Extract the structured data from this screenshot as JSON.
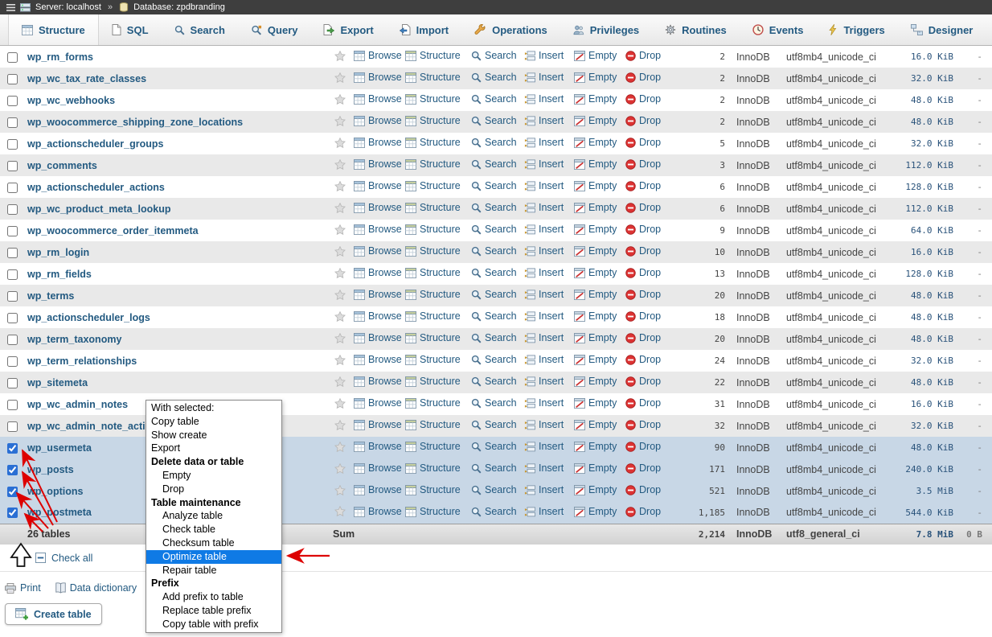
{
  "topbar": {
    "server_label": "Server: localhost",
    "separator": "»",
    "database_label": "Database: zpdbranding",
    "icons": [
      "menu-icon",
      "server-icon",
      "database-icon"
    ]
  },
  "tabs": [
    {
      "label": "Structure",
      "icon": "tab-structure",
      "active": true
    },
    {
      "label": "SQL",
      "icon": "tab-sql"
    },
    {
      "label": "Search",
      "icon": "tab-search"
    },
    {
      "label": "Query",
      "icon": "tab-query"
    },
    {
      "label": "Export",
      "icon": "tab-export"
    },
    {
      "label": "Import",
      "icon": "tab-import"
    },
    {
      "label": "Operations",
      "icon": "tab-operations"
    },
    {
      "label": "Privileges",
      "icon": "tab-privileges"
    },
    {
      "label": "Routines",
      "icon": "tab-routines"
    },
    {
      "label": "Events",
      "icon": "tab-events"
    },
    {
      "label": "Triggers",
      "icon": "tab-triggers"
    },
    {
      "label": "Designer",
      "icon": "tab-designer"
    }
  ],
  "row_actions": [
    {
      "label": "Browse",
      "icon": "browse"
    },
    {
      "label": "Structure",
      "icon": "structure"
    },
    {
      "label": "Search",
      "icon": "search"
    },
    {
      "label": "Insert",
      "icon": "insert"
    },
    {
      "label": "Empty",
      "icon": "empty"
    },
    {
      "label": "Drop",
      "icon": "drop"
    }
  ],
  "tables": [
    {
      "name": "wp_rm_forms",
      "rows": "2",
      "engine": "InnoDB",
      "collation": "utf8mb4_unicode_ci",
      "size": "16.0 KiB",
      "overhead": "-",
      "checked": false
    },
    {
      "name": "wp_wc_tax_rate_classes",
      "rows": "2",
      "engine": "InnoDB",
      "collation": "utf8mb4_unicode_ci",
      "size": "32.0 KiB",
      "overhead": "-",
      "checked": false
    },
    {
      "name": "wp_wc_webhooks",
      "rows": "2",
      "engine": "InnoDB",
      "collation": "utf8mb4_unicode_ci",
      "size": "48.0 KiB",
      "overhead": "-",
      "checked": false
    },
    {
      "name": "wp_woocommerce_shipping_zone_locations",
      "rows": "2",
      "engine": "InnoDB",
      "collation": "utf8mb4_unicode_ci",
      "size": "48.0 KiB",
      "overhead": "-",
      "checked": false
    },
    {
      "name": "wp_actionscheduler_groups",
      "rows": "5",
      "engine": "InnoDB",
      "collation": "utf8mb4_unicode_ci",
      "size": "32.0 KiB",
      "overhead": "-",
      "checked": false
    },
    {
      "name": "wp_comments",
      "rows": "3",
      "engine": "InnoDB",
      "collation": "utf8mb4_unicode_ci",
      "size": "112.0 KiB",
      "overhead": "-",
      "checked": false
    },
    {
      "name": "wp_actionscheduler_actions",
      "rows": "6",
      "engine": "InnoDB",
      "collation": "utf8mb4_unicode_ci",
      "size": "128.0 KiB",
      "overhead": "-",
      "checked": false
    },
    {
      "name": "wp_wc_product_meta_lookup",
      "rows": "6",
      "engine": "InnoDB",
      "collation": "utf8mb4_unicode_ci",
      "size": "112.0 KiB",
      "overhead": "-",
      "checked": false
    },
    {
      "name": "wp_woocommerce_order_itemmeta",
      "rows": "9",
      "engine": "InnoDB",
      "collation": "utf8mb4_unicode_ci",
      "size": "64.0 KiB",
      "overhead": "-",
      "checked": false
    },
    {
      "name": "wp_rm_login",
      "rows": "10",
      "engine": "InnoDB",
      "collation": "utf8mb4_unicode_ci",
      "size": "16.0 KiB",
      "overhead": "-",
      "checked": false
    },
    {
      "name": "wp_rm_fields",
      "rows": "13",
      "engine": "InnoDB",
      "collation": "utf8mb4_unicode_ci",
      "size": "128.0 KiB",
      "overhead": "-",
      "checked": false
    },
    {
      "name": "wp_terms",
      "rows": "20",
      "engine": "InnoDB",
      "collation": "utf8mb4_unicode_ci",
      "size": "48.0 KiB",
      "overhead": "-",
      "checked": false
    },
    {
      "name": "wp_actionscheduler_logs",
      "rows": "18",
      "engine": "InnoDB",
      "collation": "utf8mb4_unicode_ci",
      "size": "48.0 KiB",
      "overhead": "-",
      "checked": false
    },
    {
      "name": "wp_term_taxonomy",
      "rows": "20",
      "engine": "InnoDB",
      "collation": "utf8mb4_unicode_ci",
      "size": "48.0 KiB",
      "overhead": "-",
      "checked": false
    },
    {
      "name": "wp_term_relationships",
      "rows": "24",
      "engine": "InnoDB",
      "collation": "utf8mb4_unicode_ci",
      "size": "32.0 KiB",
      "overhead": "-",
      "checked": false
    },
    {
      "name": "wp_sitemeta",
      "rows": "22",
      "engine": "InnoDB",
      "collation": "utf8mb4_unicode_ci",
      "size": "48.0 KiB",
      "overhead": "-",
      "checked": false
    },
    {
      "name": "wp_wc_admin_notes",
      "rows": "31",
      "engine": "InnoDB",
      "collation": "utf8mb4_unicode_ci",
      "size": "16.0 KiB",
      "overhead": "-",
      "checked": false
    },
    {
      "name": "wp_wc_admin_note_actions",
      "rows": "32",
      "engine": "InnoDB",
      "collation": "utf8mb4_unicode_ci",
      "size": "32.0 KiB",
      "overhead": "-",
      "checked": false
    },
    {
      "name": "wp_usermeta",
      "rows": "90",
      "engine": "InnoDB",
      "collation": "utf8mb4_unicode_ci",
      "size": "48.0 KiB",
      "overhead": "-",
      "checked": true
    },
    {
      "name": "wp_posts",
      "rows": "171",
      "engine": "InnoDB",
      "collation": "utf8mb4_unicode_ci",
      "size": "240.0 KiB",
      "overhead": "-",
      "checked": true
    },
    {
      "name": "wp_options",
      "rows": "521",
      "engine": "InnoDB",
      "collation": "utf8mb4_unicode_ci",
      "size": "3.5 MiB",
      "overhead": "-",
      "checked": true
    },
    {
      "name": "wp_postmeta",
      "rows": "1,185",
      "engine": "InnoDB",
      "collation": "utf8mb4_unicode_ci",
      "size": "544.0 KiB",
      "overhead": "-",
      "checked": true
    }
  ],
  "sum_row": {
    "tables_label": "26 tables",
    "sum_label": "Sum",
    "rows": "2,214",
    "engine": "InnoDB",
    "collation": "utf8_general_ci",
    "size": "7.8 MiB",
    "overhead": "0 B"
  },
  "footer": {
    "check_all_label": "Check all",
    "print_label": "Print",
    "data_dictionary_label": "Data dictionary",
    "create_table_label": "Create table"
  },
  "with_selected_menu": {
    "items": [
      {
        "label": "With selected:",
        "style": "plain"
      },
      {
        "label": "Copy table",
        "style": "plain"
      },
      {
        "label": "Show create",
        "style": "plain"
      },
      {
        "label": "Export",
        "style": "plain"
      },
      {
        "label": "Delete data or table",
        "style": "header"
      },
      {
        "label": "Empty",
        "style": "sub"
      },
      {
        "label": "Drop",
        "style": "sub"
      },
      {
        "label": "Table maintenance",
        "style": "header"
      },
      {
        "label": "Analyze table",
        "style": "sub"
      },
      {
        "label": "Check table",
        "style": "sub"
      },
      {
        "label": "Checksum table",
        "style": "sub"
      },
      {
        "label": "Optimize table",
        "style": "sub",
        "selected": true
      },
      {
        "label": "Repair table",
        "style": "sub"
      },
      {
        "label": "Prefix",
        "style": "header"
      },
      {
        "label": "Add prefix to table",
        "style": "sub"
      },
      {
        "label": "Replace table prefix",
        "style": "sub"
      },
      {
        "label": "Copy table with prefix",
        "style": "sub"
      }
    ]
  },
  "colors": {
    "link": "#235a81",
    "selected_row": "#c8d7e6",
    "menu_highlight": "#0f7ae5",
    "annotation_red": "#dd0000",
    "topbar_bg": "#3e3e3e"
  }
}
